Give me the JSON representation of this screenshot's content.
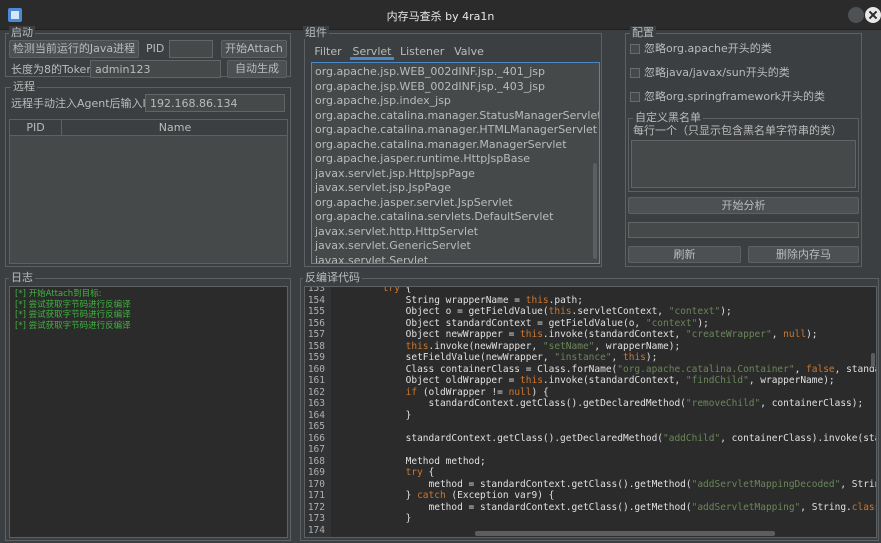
{
  "window": {
    "title": "内存马查杀 by 4ra1n"
  },
  "start": {
    "group_title": "启动",
    "detect_button": "检测当前运行的Java进程",
    "pid_label": "PID",
    "pid_value": "",
    "attach_button": "开始Attach",
    "token_label": "长度为8的Token",
    "token_value": "admin123",
    "autogen_button": "自动生成"
  },
  "remote": {
    "group_title": "远程",
    "ip_label": "远程手动注入Agent后输入IP",
    "ip_value": "192.168.86.134"
  },
  "process_table": {
    "columns": [
      "PID",
      "Name"
    ]
  },
  "components": {
    "group_title": "组件",
    "tabs": [
      "Filter",
      "Servlet",
      "Listener",
      "Valve"
    ],
    "active_tab": "Servlet",
    "classes": [
      "org.apache.jsp.WEB_002dINF.jsp._401_jsp",
      "org.apache.jsp.WEB_002dINF.jsp._403_jsp",
      "org.apache.jsp.index_jsp",
      "org.apache.catalina.manager.StatusManagerServlet",
      "org.apache.catalina.manager.HTMLManagerServlet",
      "org.apache.catalina.manager.ManagerServlet",
      "org.apache.jasper.runtime.HttpJspBase",
      "javax.servlet.jsp.HttpJspPage",
      "javax.servlet.jsp.JspPage",
      "org.apache.jasper.servlet.JspServlet",
      "org.apache.catalina.servlets.DefaultServlet",
      "javax.servlet.http.HttpServlet",
      "javax.servlet.GenericServlet",
      "javax.servlet.Servlet"
    ]
  },
  "config": {
    "group_title": "配置",
    "options": [
      "忽略org.apache开头的类",
      "忽略java/javax/sun开头的类",
      "忽略org.springframework开头的类"
    ],
    "blacklist_title": "自定义黑名单",
    "blacklist_hint": "每行一个（只显示包含黑名单字符串的类）",
    "analyze_button": "开始分析",
    "refresh_button": "刷新",
    "delete_button": "删除内存马"
  },
  "log": {
    "group_title": "日志",
    "lines": [
      "[*] 开始Attach到目标:",
      "[*] 尝试获取字节码进行反编译",
      "[*] 尝试获取字节码进行反编译",
      "[*] 尝试获取字节码进行反编译"
    ]
  },
  "code": {
    "group_title": "反编译代码",
    "line_numbers": [
      "153",
      "154",
      "155",
      "156",
      "157",
      "158",
      "159",
      "160",
      "161",
      "162",
      "163",
      "164",
      "165",
      "166",
      "167",
      "168",
      "169",
      "170",
      "171",
      "172",
      "173",
      "174"
    ]
  }
}
